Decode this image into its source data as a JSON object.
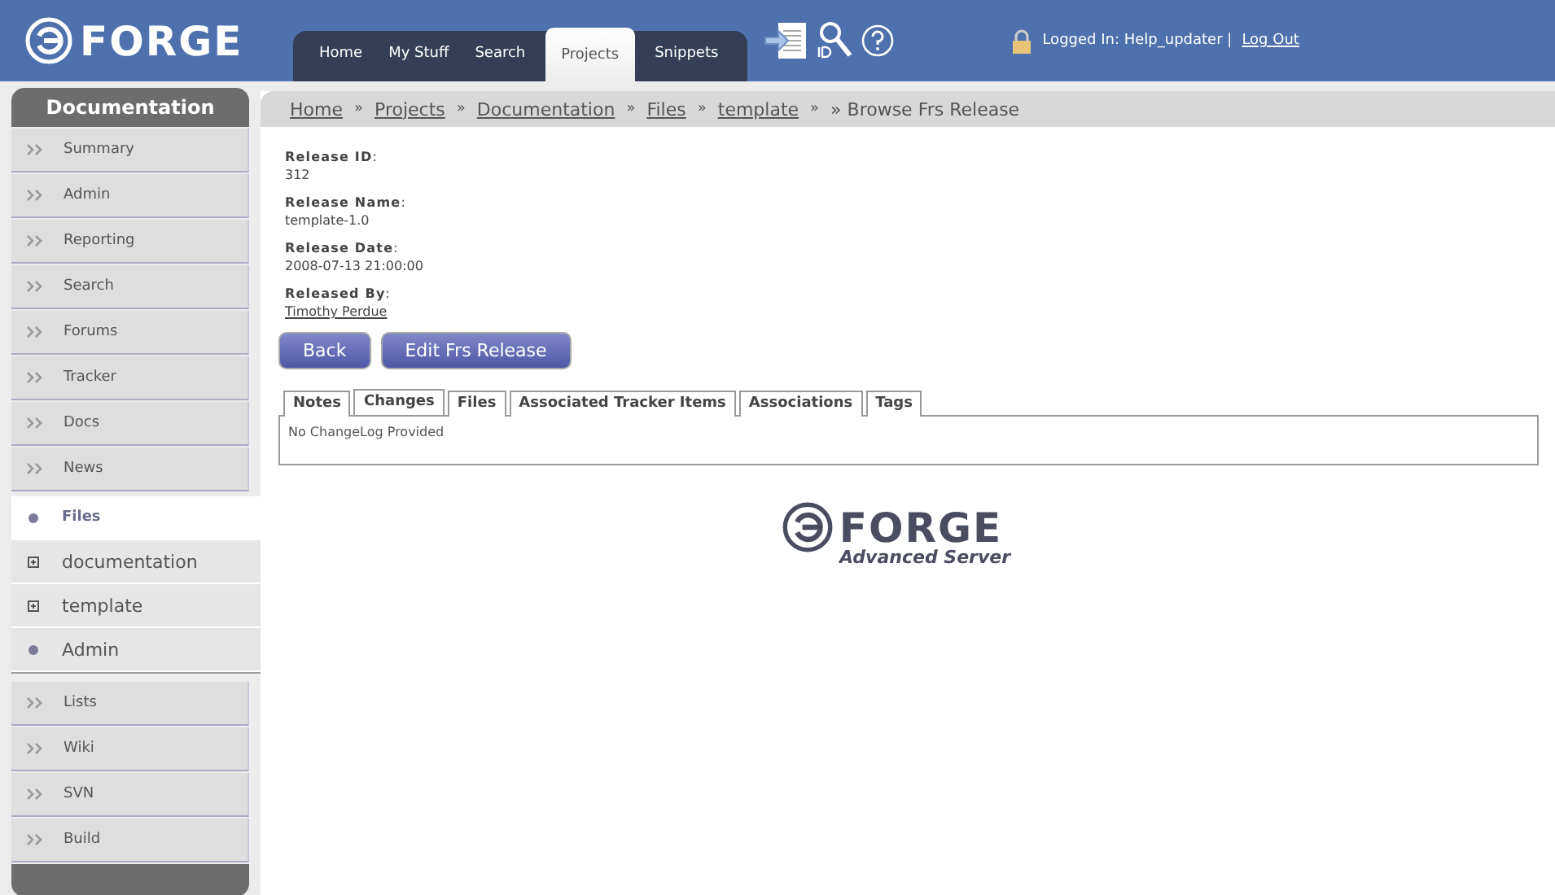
{
  "header": {
    "logo": "FORGE",
    "nav": [
      {
        "label": "Home",
        "selected": false
      },
      {
        "label": "My Stuff",
        "selected": false
      },
      {
        "label": "Search",
        "selected": false
      },
      {
        "label": "Projects",
        "selected": true
      },
      {
        "label": "Snippets",
        "selected": false
      }
    ],
    "login_text": "Logged In: Help_updater |",
    "logout": "Log Out"
  },
  "sidebar": {
    "title": "Documentation",
    "items": [
      {
        "label": "Summary",
        "kind": "link"
      },
      {
        "label": "Admin",
        "kind": "link"
      },
      {
        "label": "Reporting",
        "kind": "link"
      },
      {
        "label": "Search",
        "kind": "link"
      },
      {
        "label": "Forums",
        "kind": "link"
      },
      {
        "label": "Tracker",
        "kind": "link"
      },
      {
        "label": "Docs",
        "kind": "link"
      },
      {
        "label": "News",
        "kind": "link"
      }
    ],
    "section": [
      {
        "label": "Files",
        "kind": "bullet",
        "selected": true
      },
      {
        "label": "documentation",
        "kind": "expand",
        "selected": false
      },
      {
        "label": "template",
        "kind": "expand",
        "selected": false
      },
      {
        "label": "Admin",
        "kind": "bullet",
        "selected": false
      }
    ],
    "items_after": [
      {
        "label": "Lists",
        "kind": "link"
      },
      {
        "label": "Wiki",
        "kind": "link"
      },
      {
        "label": "SVN",
        "kind": "link"
      },
      {
        "label": "Build",
        "kind": "link"
      }
    ]
  },
  "breadcrumb": {
    "links": [
      "Home",
      "Projects",
      "Documentation",
      "Files",
      "template"
    ],
    "separator": "»",
    "current": "» Browse Frs Release"
  },
  "fields": [
    {
      "label": "**Release ID**:",
      "value": "312",
      "kind": "text"
    },
    {
      "label": "**Release Name**:",
      "value": "template-1.0",
      "kind": "text"
    },
    {
      "label": "**Release Date**:",
      "value": "2008-07-13 21:00:00",
      "kind": "text"
    },
    {
      "label": "**Released By**:",
      "value": "Timothy Perdue",
      "kind": "link"
    }
  ],
  "buttons": [
    "Back",
    "Edit Frs Release"
  ],
  "tabs": [
    {
      "label": "Notes",
      "selected": false
    },
    {
      "label": "Changes",
      "selected": true
    },
    {
      "label": "Files",
      "selected": false
    },
    {
      "label": "Associated Tracker Items",
      "selected": false
    },
    {
      "label": "Associations",
      "selected": false
    },
    {
      "label": "Tags",
      "selected": false
    }
  ],
  "tab_content": "No ChangeLog Provided",
  "footer_logo": {
    "name": "FORGE",
    "subtitle": "Advanced Server"
  }
}
